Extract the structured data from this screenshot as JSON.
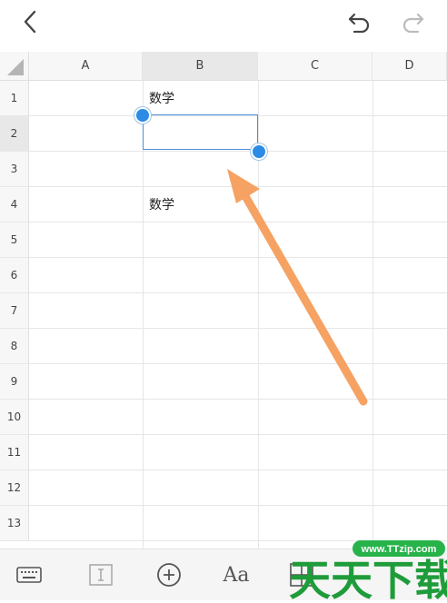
{
  "columns": [
    "A",
    "B",
    "C",
    "D"
  ],
  "rows": [
    "1",
    "2",
    "3",
    "4",
    "5",
    "6",
    "7",
    "8",
    "9",
    "10",
    "11",
    "12",
    "13"
  ],
  "cells": {
    "b1": "数学",
    "b4": "数学"
  },
  "selected_cell": "B2",
  "colors": {
    "selection": "#4a90d9",
    "handle": "#2b8be6",
    "annotation_arrow": "#f5a263"
  },
  "topbar": {
    "icons": [
      "back-icon",
      "undo-icon",
      "redo-icon"
    ]
  },
  "toolbar": {
    "icons": [
      "keyboard-icon",
      "text-cursor-icon",
      "add-circle-icon",
      "font-style-icon",
      "cell-grid-icon",
      "more-icon"
    ],
    "font_label": "Aa"
  },
  "watermark": {
    "url": "www.TTzip.com",
    "logo_text": "天天下载"
  }
}
